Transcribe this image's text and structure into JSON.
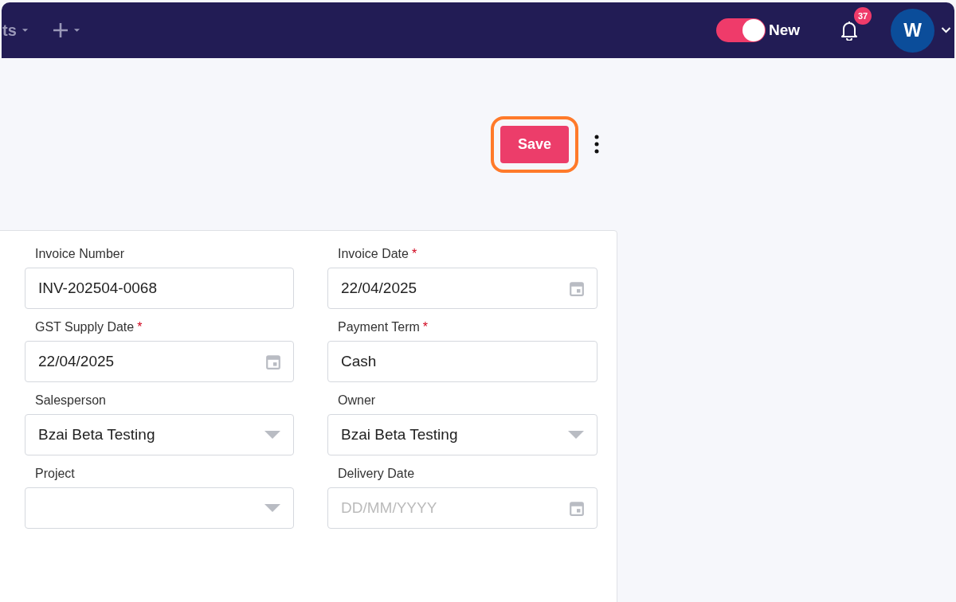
{
  "topbar": {
    "menu_fragment": "ts",
    "toggle": {
      "label": "New",
      "on": true
    },
    "notifications": {
      "count": "37"
    },
    "avatar": {
      "initial": "W"
    }
  },
  "actions": {
    "save": "Save"
  },
  "form": {
    "fields": [
      {
        "label": "Invoice Number",
        "kind": "text",
        "value": "INV-202504-0068"
      },
      {
        "label": "Invoice Date",
        "required_mark": "*",
        "kind": "date",
        "value": "22/04/2025"
      },
      {
        "label": "GST Supply Date",
        "required_mark": "*",
        "kind": "date",
        "value": "22/04/2025"
      },
      {
        "label": "Payment Term",
        "required_mark": "*",
        "kind": "text",
        "value": "Cash"
      },
      {
        "label": "Salesperson",
        "kind": "select",
        "value": "Bzai Beta Testing"
      },
      {
        "label": "Owner",
        "kind": "select",
        "value": "Bzai Beta Testing"
      },
      {
        "label": "Project",
        "kind": "select"
      },
      {
        "label": "Delivery Date",
        "kind": "date",
        "placeholder": "DD/MM/YYYY"
      }
    ]
  }
}
